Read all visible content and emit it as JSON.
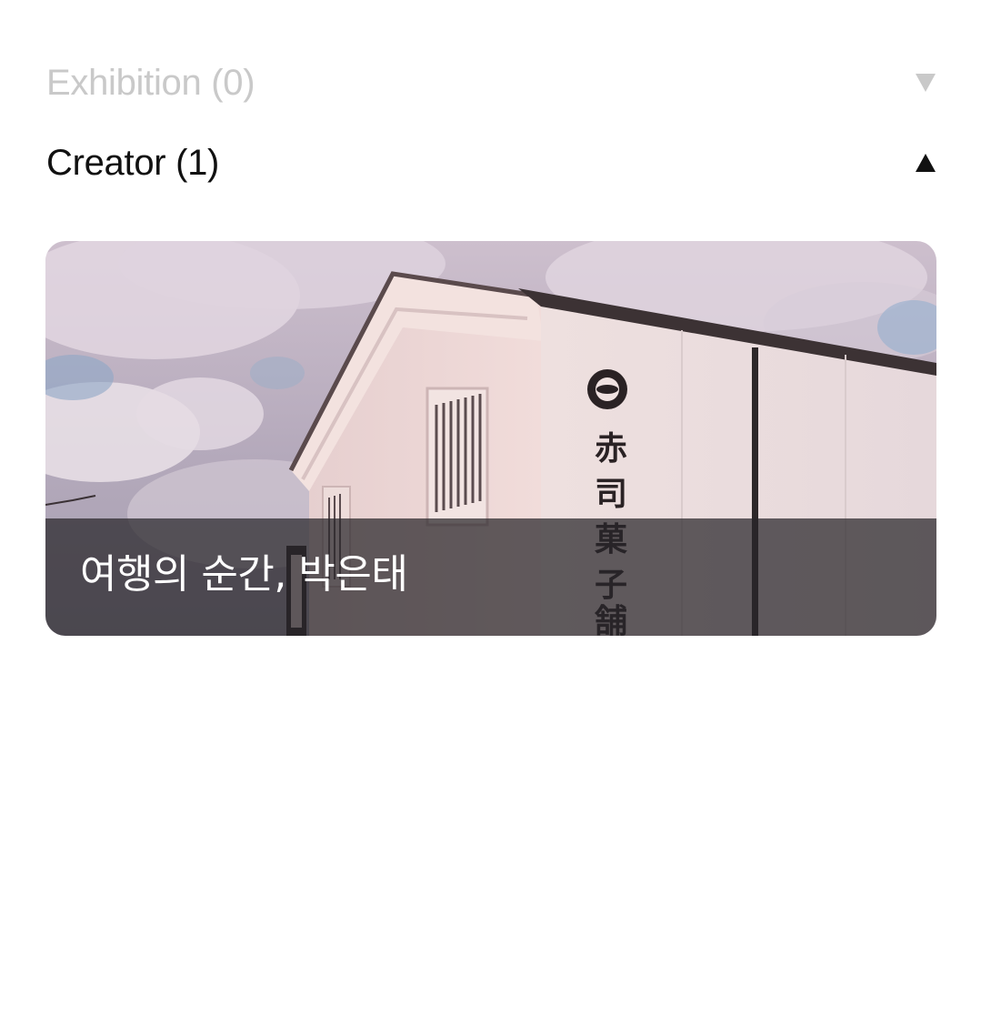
{
  "sections": [
    {
      "title": "Exhibition (0)",
      "state": "collapsed",
      "toggle_icon": "chevron-down-icon",
      "color": "#c9c9c9"
    },
    {
      "title": "Creator (1)",
      "state": "expanded",
      "toggle_icon": "chevron-up-icon",
      "color": "#111111"
    }
  ],
  "creator_card": {
    "caption": "여행의 순간, 박은태",
    "image": "building-photo",
    "sign_glyphs": [
      "赤",
      "司",
      "菓",
      "子",
      "舗"
    ]
  }
}
